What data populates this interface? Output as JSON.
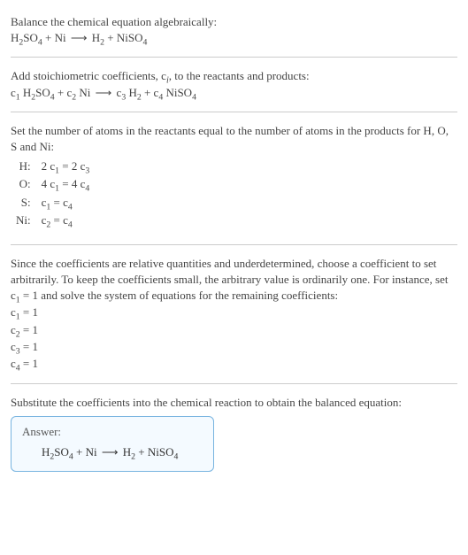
{
  "intro": {
    "line1": "Balance the chemical equation algebraically:"
  },
  "equations": {
    "unbalanced_html": "H<sub>2</sub>SO<sub>4</sub> + Ni <span class='arrow'>⟶</span> H<sub>2</sub> + NiSO<sub>4</sub>",
    "with_coeffs_html": "c<sub>1</sub> H<sub>2</sub>SO<sub>4</sub> + c<sub>2</sub> Ni <span class='arrow'>⟶</span> c<sub>3</sub> H<sub>2</sub> + c<sub>4</sub> NiSO<sub>4</sub>",
    "balanced_html": "H<sub>2</sub>SO<sub>4</sub> + Ni <span class='arrow'>⟶</span> H<sub>2</sub> + NiSO<sub>4</sub>"
  },
  "step_add_coeffs_html": "Add stoichiometric coefficients, c<span class='sub-i'>i</span>, to the reactants and products:",
  "step_set_atoms": "Set the number of atoms in the reactants equal to the number of atoms in the products for H, O, S and Ni:",
  "atom_equations": [
    {
      "label": "H:",
      "eq_html": "2 c<sub>1</sub> = 2 c<sub>3</sub>"
    },
    {
      "label": "O:",
      "eq_html": "4 c<sub>1</sub> = 4 c<sub>4</sub>"
    },
    {
      "label": "S:",
      "eq_html": "c<sub>1</sub> = c<sub>4</sub>"
    },
    {
      "label": "Ni:",
      "eq_html": "c<sub>2</sub> = c<sub>4</sub>"
    }
  ],
  "step_choose_html": "Since the coefficients are relative quantities and underdetermined, choose a coefficient to set arbitrarily. To keep the coefficients small, the arbitrary value is ordinarily one. For instance, set c<sub>1</sub> = 1 and solve the system of equations for the remaining coefficients:",
  "coef_solutions": [
    "c<sub>1</sub> = 1",
    "c<sub>2</sub> = 1",
    "c<sub>3</sub> = 1",
    "c<sub>4</sub> = 1"
  ],
  "step_substitute": "Substitute the coefficients into the chemical reaction to obtain the balanced equation:",
  "answer_label": "Answer:"
}
